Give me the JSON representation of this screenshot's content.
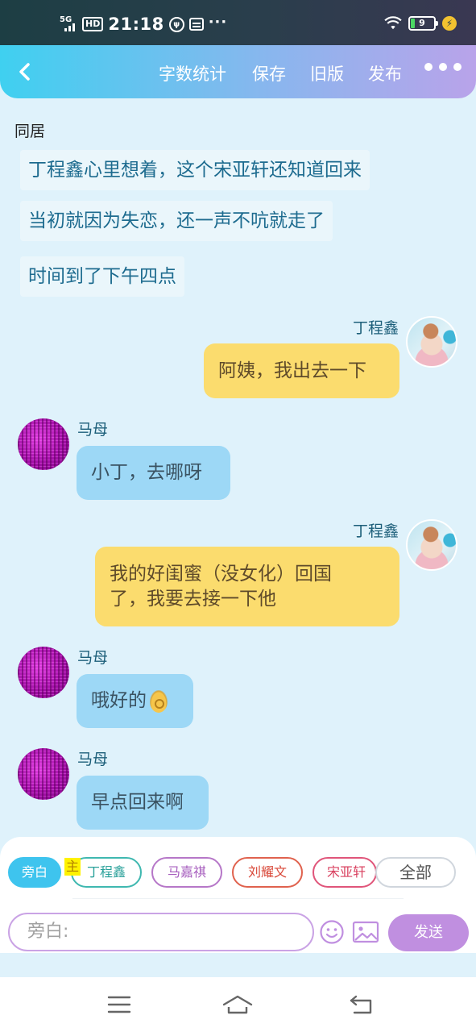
{
  "status_bar": {
    "network": "5G",
    "hd": "HD",
    "time": "21:18",
    "circle_glyph": "ψ",
    "more": "···",
    "battery": "9",
    "bolt": "⚡"
  },
  "header": {
    "actions": [
      "字数统计",
      "保存",
      "旧版",
      "发布"
    ]
  },
  "chat": {
    "title": "同居",
    "narration": [
      "丁程鑫心里想着，这个宋亚轩还知道回来",
      "当初就因为失恋，还一声不吭就走了",
      "时间到了下午四点"
    ],
    "messages": [
      {
        "speaker": "丁程鑫",
        "side": "right",
        "text": "阿姨，我出去一下"
      },
      {
        "speaker": "马母",
        "side": "left",
        "text": "小丁，去哪呀"
      },
      {
        "speaker": "丁程鑫",
        "side": "right",
        "text_line1": "我的好闺蜜（没女化）回国",
        "text_line2": "了，我要去接一下他"
      },
      {
        "speaker": "马母",
        "side": "left",
        "text": "哦好的"
      },
      {
        "speaker": "马母",
        "side": "left",
        "text": "早点回来啊"
      }
    ]
  },
  "input_panel": {
    "characters": [
      "旁白",
      "丁程鑫",
      "马嘉祺",
      "刘耀文",
      "宋亚轩"
    ],
    "main_badge": "主",
    "all_button": "全部",
    "placeholder": "旁白:",
    "send_label": "发送"
  },
  "colors": {
    "narration_text": "#1d6b8f",
    "bubble_right": "#fbdc6e",
    "bubble_left": "#9dd8f6",
    "selected_chip": "#3ec4ee",
    "send_button": "#c08fe0"
  }
}
